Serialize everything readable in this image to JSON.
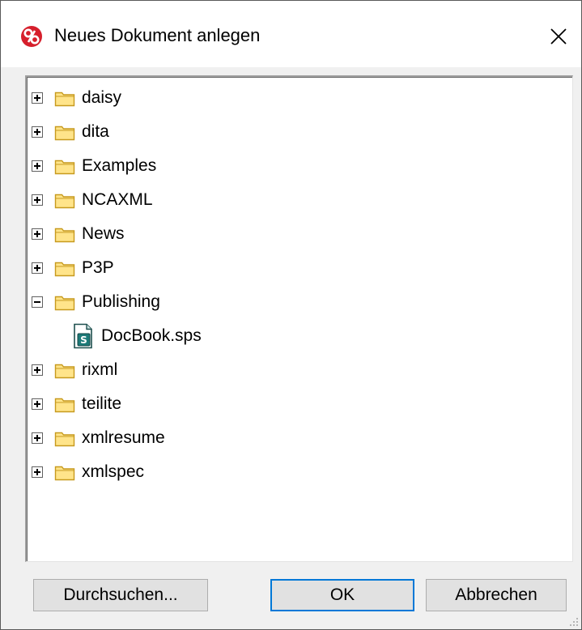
{
  "window": {
    "title": "Neues Dokument anlegen",
    "close_symbol": "✕"
  },
  "tree": {
    "items": [
      {
        "label": "daisy",
        "type": "folder",
        "state": "collapsed"
      },
      {
        "label": "dita",
        "type": "folder",
        "state": "collapsed"
      },
      {
        "label": "Examples",
        "type": "folder",
        "state": "collapsed"
      },
      {
        "label": "NCAXML",
        "type": "folder",
        "state": "collapsed"
      },
      {
        "label": "News",
        "type": "folder",
        "state": "collapsed"
      },
      {
        "label": "P3P",
        "type": "folder",
        "state": "collapsed"
      },
      {
        "label": "Publishing",
        "type": "folder",
        "state": "expanded"
      },
      {
        "label": "DocBook.sps",
        "type": "file",
        "icon_letter": "S"
      },
      {
        "label": "rixml",
        "type": "folder",
        "state": "collapsed"
      },
      {
        "label": "teilite",
        "type": "folder",
        "state": "collapsed"
      },
      {
        "label": "xmlresume",
        "type": "folder",
        "state": "collapsed"
      },
      {
        "label": "xmlspec",
        "type": "folder",
        "state": "collapsed"
      }
    ]
  },
  "buttons": {
    "browse_label": "Durchsuchen...",
    "ok_label": "OK",
    "cancel_label": "Abbrechen"
  },
  "colors": {
    "app_icon": "#d61f2c",
    "folder_fill": "#ffe48a",
    "folder_stroke": "#c79a1e",
    "file_accent": "#1d7a78",
    "default_button_border": "#0078d7"
  }
}
